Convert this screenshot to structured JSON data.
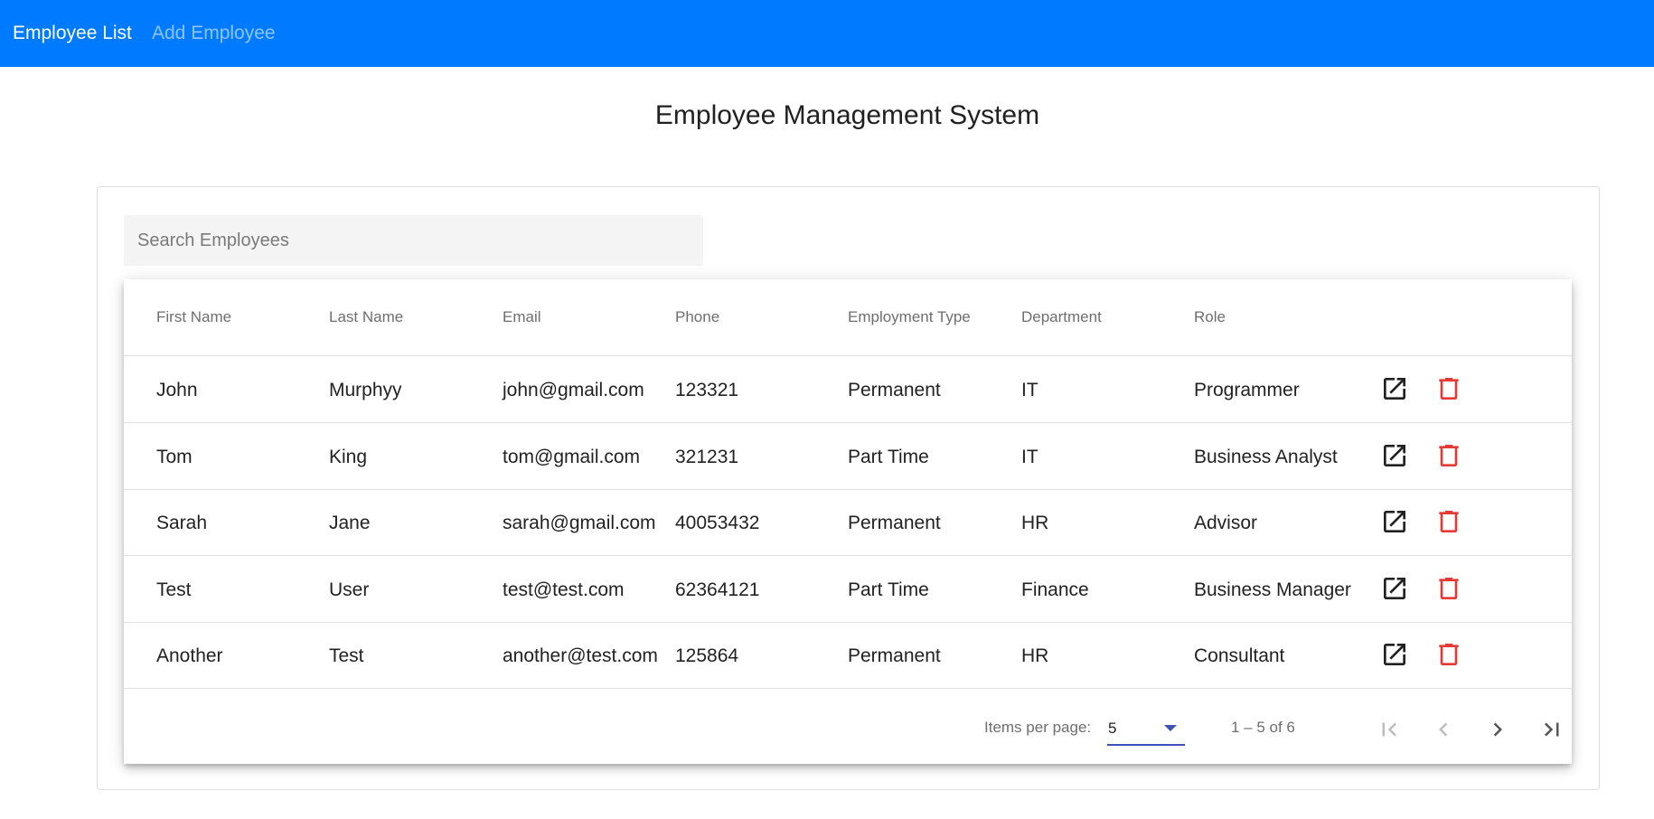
{
  "nav": {
    "employee_list": "Employee List",
    "add_employee": "Add Employee"
  },
  "page_title": "Employee Management System",
  "search": {
    "placeholder": "Search Employees",
    "value": ""
  },
  "table": {
    "headers": [
      "First Name",
      "Last Name",
      "Email",
      "Phone",
      "Employment Type",
      "Department",
      "Role"
    ],
    "rows": [
      [
        "John",
        "Murphyy",
        "john@gmail.com",
        "123321",
        "Permanent",
        "IT",
        "Programmer"
      ],
      [
        "Tom",
        "King",
        "tom@gmail.com",
        "321231",
        "Part Time",
        "IT",
        "Business Analyst"
      ],
      [
        "Sarah",
        "Jane",
        "sarah@gmail.com",
        "40053432",
        "Permanent",
        "HR",
        "Advisor"
      ],
      [
        "Test",
        "User",
        "test@test.com",
        "62364121",
        "Part Time",
        "Finance",
        "Business Manager"
      ],
      [
        "Another",
        "Test",
        "another@test.com",
        "125864",
        "Permanent",
        "HR",
        "Consultant"
      ]
    ],
    "actions": {
      "edit_icon": "open-in-new-icon",
      "delete_icon": "trash-icon"
    }
  },
  "paginator": {
    "items_per_page_label": "Items per page:",
    "items_per_page_value": "5",
    "range_label": "1 – 5 of 6"
  },
  "colors": {
    "topbar": "#007bff",
    "delete": "#e53935",
    "select_underline": "#3f51b5",
    "disabled_icon": "#bdbdbd"
  }
}
